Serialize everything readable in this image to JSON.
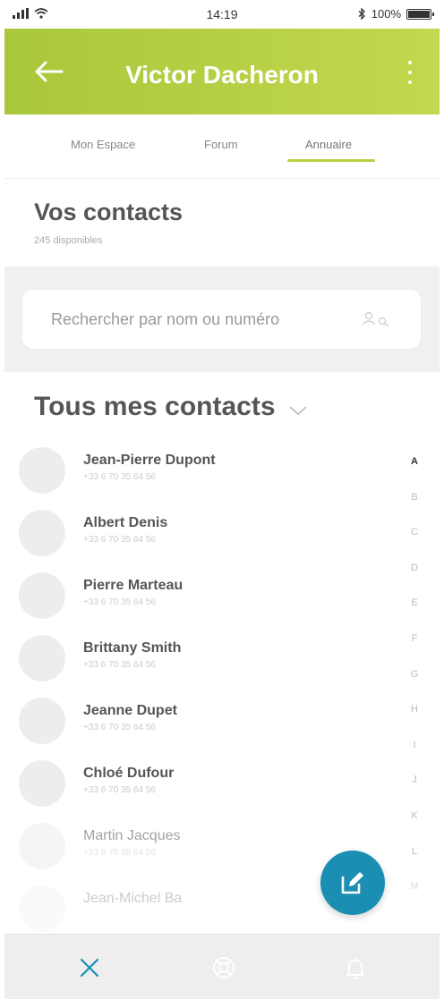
{
  "status_bar": {
    "time": "14:19",
    "battery": "100%"
  },
  "app_bar": {
    "title": "Victor Dacheron"
  },
  "tabs": [
    {
      "label": "Mon Espace"
    },
    {
      "label": "Forum"
    },
    {
      "label": "Annuaire",
      "active": true
    }
  ],
  "section": {
    "title": "Vos contacts",
    "subtitle": "245 disponibles"
  },
  "search": {
    "placeholder": "Rechercher par nom ou numéro"
  },
  "list": {
    "title": "Tous mes contacts",
    "contacts": [
      {
        "name": "Jean-Pierre Dupont",
        "phone": "+33 6 70 35 64 56"
      },
      {
        "name": "Albert Denis",
        "phone": "+33 6 70 35 64 56"
      },
      {
        "name": "Pierre Marteau",
        "phone": "+33 6 70 35 64 56"
      },
      {
        "name": "Brittany Smith",
        "phone": "+33 6 70 35 64 56"
      },
      {
        "name": "Jeanne Dupet",
        "phone": "+33 6 70 35 64 56"
      },
      {
        "name": "Chloé Dufour",
        "phone": "+33 6 70 35 64 56"
      },
      {
        "name": "Martin Jacques",
        "phone": "+33 6 70 35 64 56"
      },
      {
        "name": "Jean-Michel Ba",
        "phone": ""
      }
    ]
  },
  "alphabet": [
    "A",
    "B",
    "C",
    "D",
    "E",
    "F",
    "G",
    "H",
    "I",
    "J",
    "K",
    "L",
    "M"
  ],
  "colors": {
    "accent": "#b7d03f",
    "fab": "#1a8fb3",
    "bottom_active": "#1a8fb3"
  },
  "icons": {
    "back": "arrow-left-icon",
    "menu": "more-vertical-icon",
    "search": "contact-search-icon",
    "dropdown": "chevron-down-icon",
    "fab": "edit-icon",
    "bottom": [
      "close-icon",
      "lifebuoy-icon",
      "bell-icon"
    ]
  }
}
